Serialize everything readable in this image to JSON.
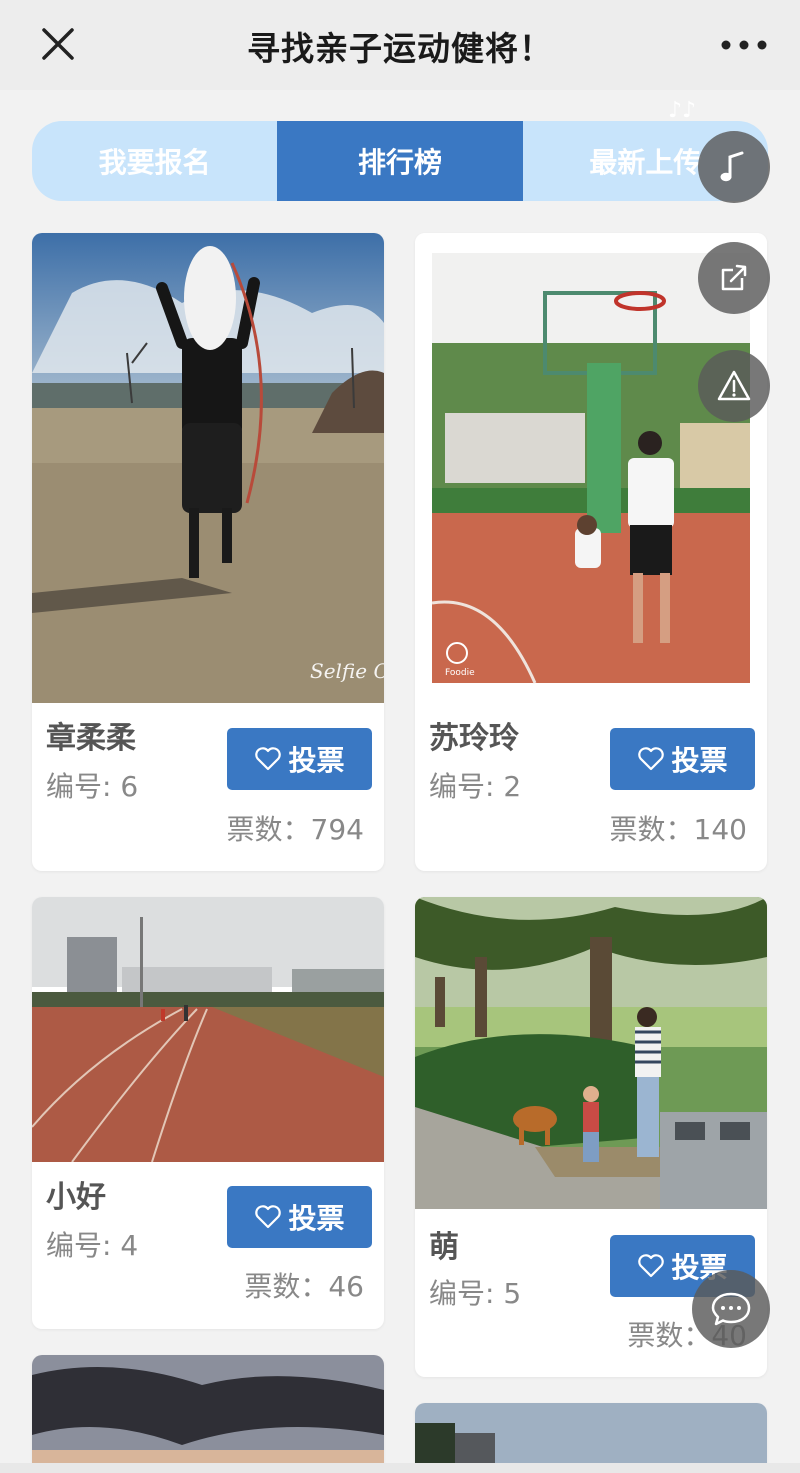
{
  "header": {
    "title": "寻找亲子运动健将！"
  },
  "tabs": [
    {
      "label": "我要报名",
      "active": false
    },
    {
      "label": "排行榜",
      "active": true
    },
    {
      "label": "最新上传",
      "active": false
    }
  ],
  "vote_label": "投票",
  "colors": {
    "accent": "#3a78c3",
    "tab_inactive": "#c8e4fb"
  },
  "entries": [
    {
      "name": "章柔柔",
      "number": "编号: 6",
      "votes": "票数：794"
    },
    {
      "name": "苏玲玲",
      "number": "编号: 2",
      "votes": "票数：140"
    },
    {
      "name": "小好",
      "number": "编号: 4",
      "votes": "票数：46"
    },
    {
      "name": "萌",
      "number": "编号: 5",
      "votes": "票数：40"
    }
  ],
  "icons": {
    "close": "close-icon",
    "more": "more-dots-icon",
    "music": "music-note-icon",
    "share": "share-icon",
    "report": "warning-icon",
    "chat": "chat-bubble-icon",
    "heart": "heart-outline-icon"
  },
  "photo_watermarks": {
    "entry_1": "Selfie City",
    "entry_2": "Foodie"
  }
}
